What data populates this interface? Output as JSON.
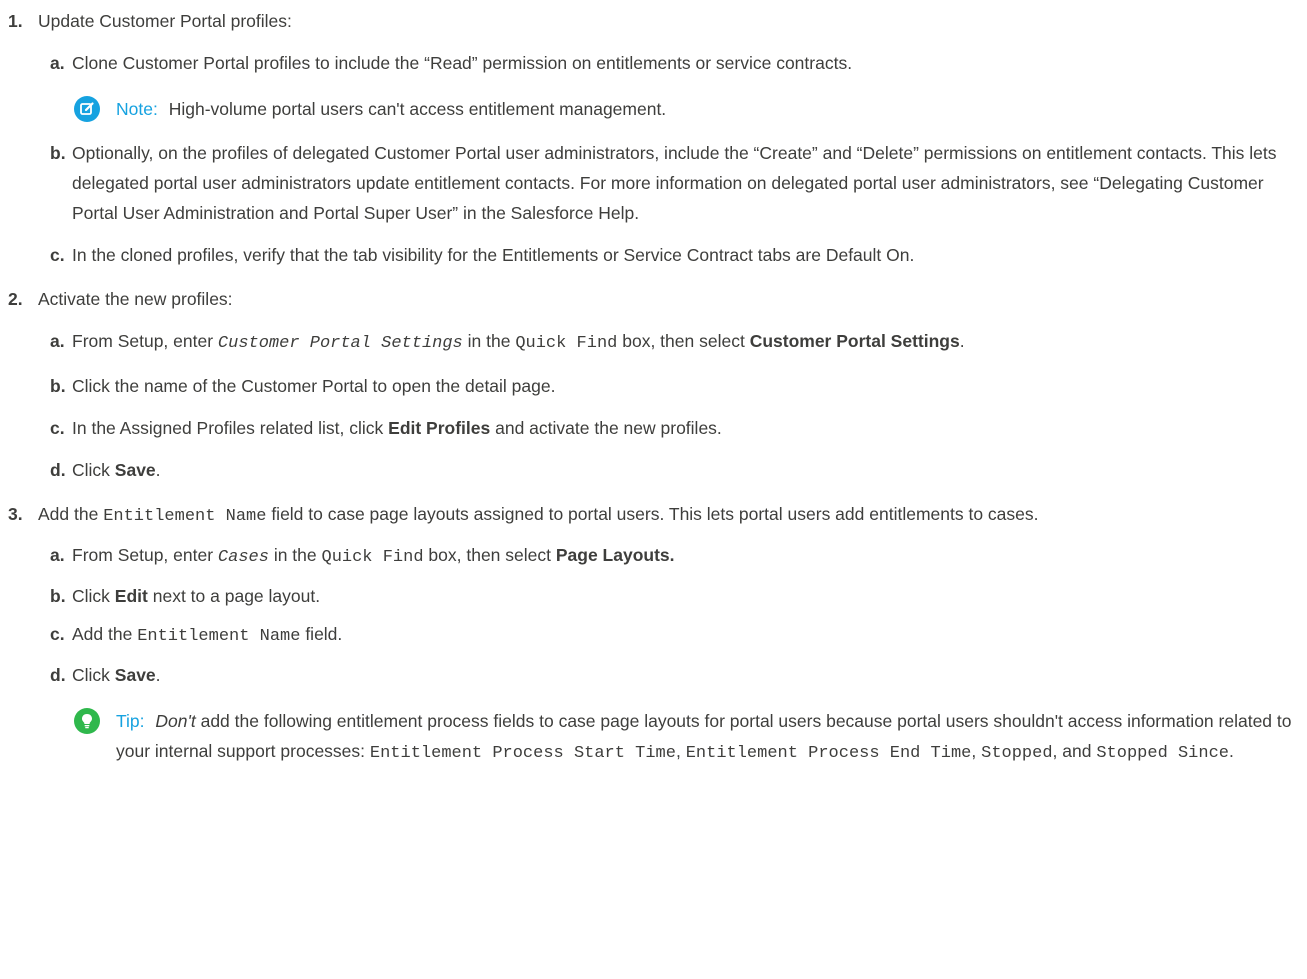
{
  "steps": [
    {
      "num": "1.",
      "text": "Update Customer Portal profiles:",
      "subs": [
        {
          "letter": "a.",
          "text": "Clone Customer Portal profiles to include the “Read” permission on entitlements or service contracts."
        },
        {
          "letter": "b.",
          "text": "Optionally, on the profiles of delegated Customer Portal user administrators, include the “Create” and “Delete” permissions on entitlement contacts. This lets delegated portal user administrators update entitlement contacts. For more information on delegated portal user administrators, see “Delegating Customer Portal User Administration and Portal Super User” in the Salesforce Help."
        },
        {
          "letter": "c.",
          "text": "In the cloned profiles, verify that the tab visibility for the Entitlements or Service Contract tabs are Default On."
        }
      ],
      "note": {
        "label": "Note:",
        "text": "High-volume portal users can't access entitlement management.",
        "icon": "edit-note-icon"
      }
    },
    {
      "num": "2.",
      "text": "Activate the new profiles:",
      "subs": [
        {
          "letter": "a.",
          "p1": "From Setup, enter",
          "code1": "Customer Portal Settings",
          "p2": "in the",
          "code2": "Quick Find",
          "p3": "box, then select",
          "bold": "Customer Portal Settings",
          "p4": "."
        },
        {
          "letter": "b.",
          "text": "Click the name of the Customer Portal to open the detail page."
        },
        {
          "letter": "c.",
          "p1": "In the Assigned Profiles related list, click",
          "bold": "Edit Profiles",
          "p2": "and activate the new profiles."
        },
        {
          "letter": "d.",
          "p1": "Click",
          "bold": "Save",
          "p2": "."
        }
      ]
    },
    {
      "num": "3.",
      "p1": "Add the",
      "code": "Entitlement Name",
      "p2": "field to case page layouts assigned to portal users. This lets portal users add entitlements to cases.",
      "subs": [
        {
          "letter": "a.",
          "p1": "From Setup, enter",
          "code1": "Cases",
          "p2": "in the",
          "code2": "Quick Find",
          "p3": "box, then select",
          "bold": "Page Layouts."
        },
        {
          "letter": "b.",
          "p1": "Click",
          "bold": "Edit",
          "p2": "next to a page layout."
        },
        {
          "letter": "c.",
          "p1": "Add the",
          "code": "Entitlement Name",
          "p2": "field."
        },
        {
          "letter": "d.",
          "p1": "Click",
          "bold": "Save",
          "p2": "."
        }
      ],
      "tip": {
        "label": "Tip:",
        "em": "Don't",
        "p1": "add the following entitlement process fields to case page layouts for portal users because portal users shouldn't access information related to your internal support processes:",
        "code1": "Entitlement Process Start Time",
        "sep1": ",",
        "code2": "Entitlement Process End Time",
        "sep2": ",",
        "code3": "Stopped",
        "sep3": ", and",
        "code4": "Stopped Since",
        "end": ".",
        "icon": "lightbulb-icon"
      }
    }
  ],
  "colors": {
    "note_accent": "#16a2e0",
    "tip_accent": "#2fb84c",
    "text": "#3e3e3c"
  }
}
